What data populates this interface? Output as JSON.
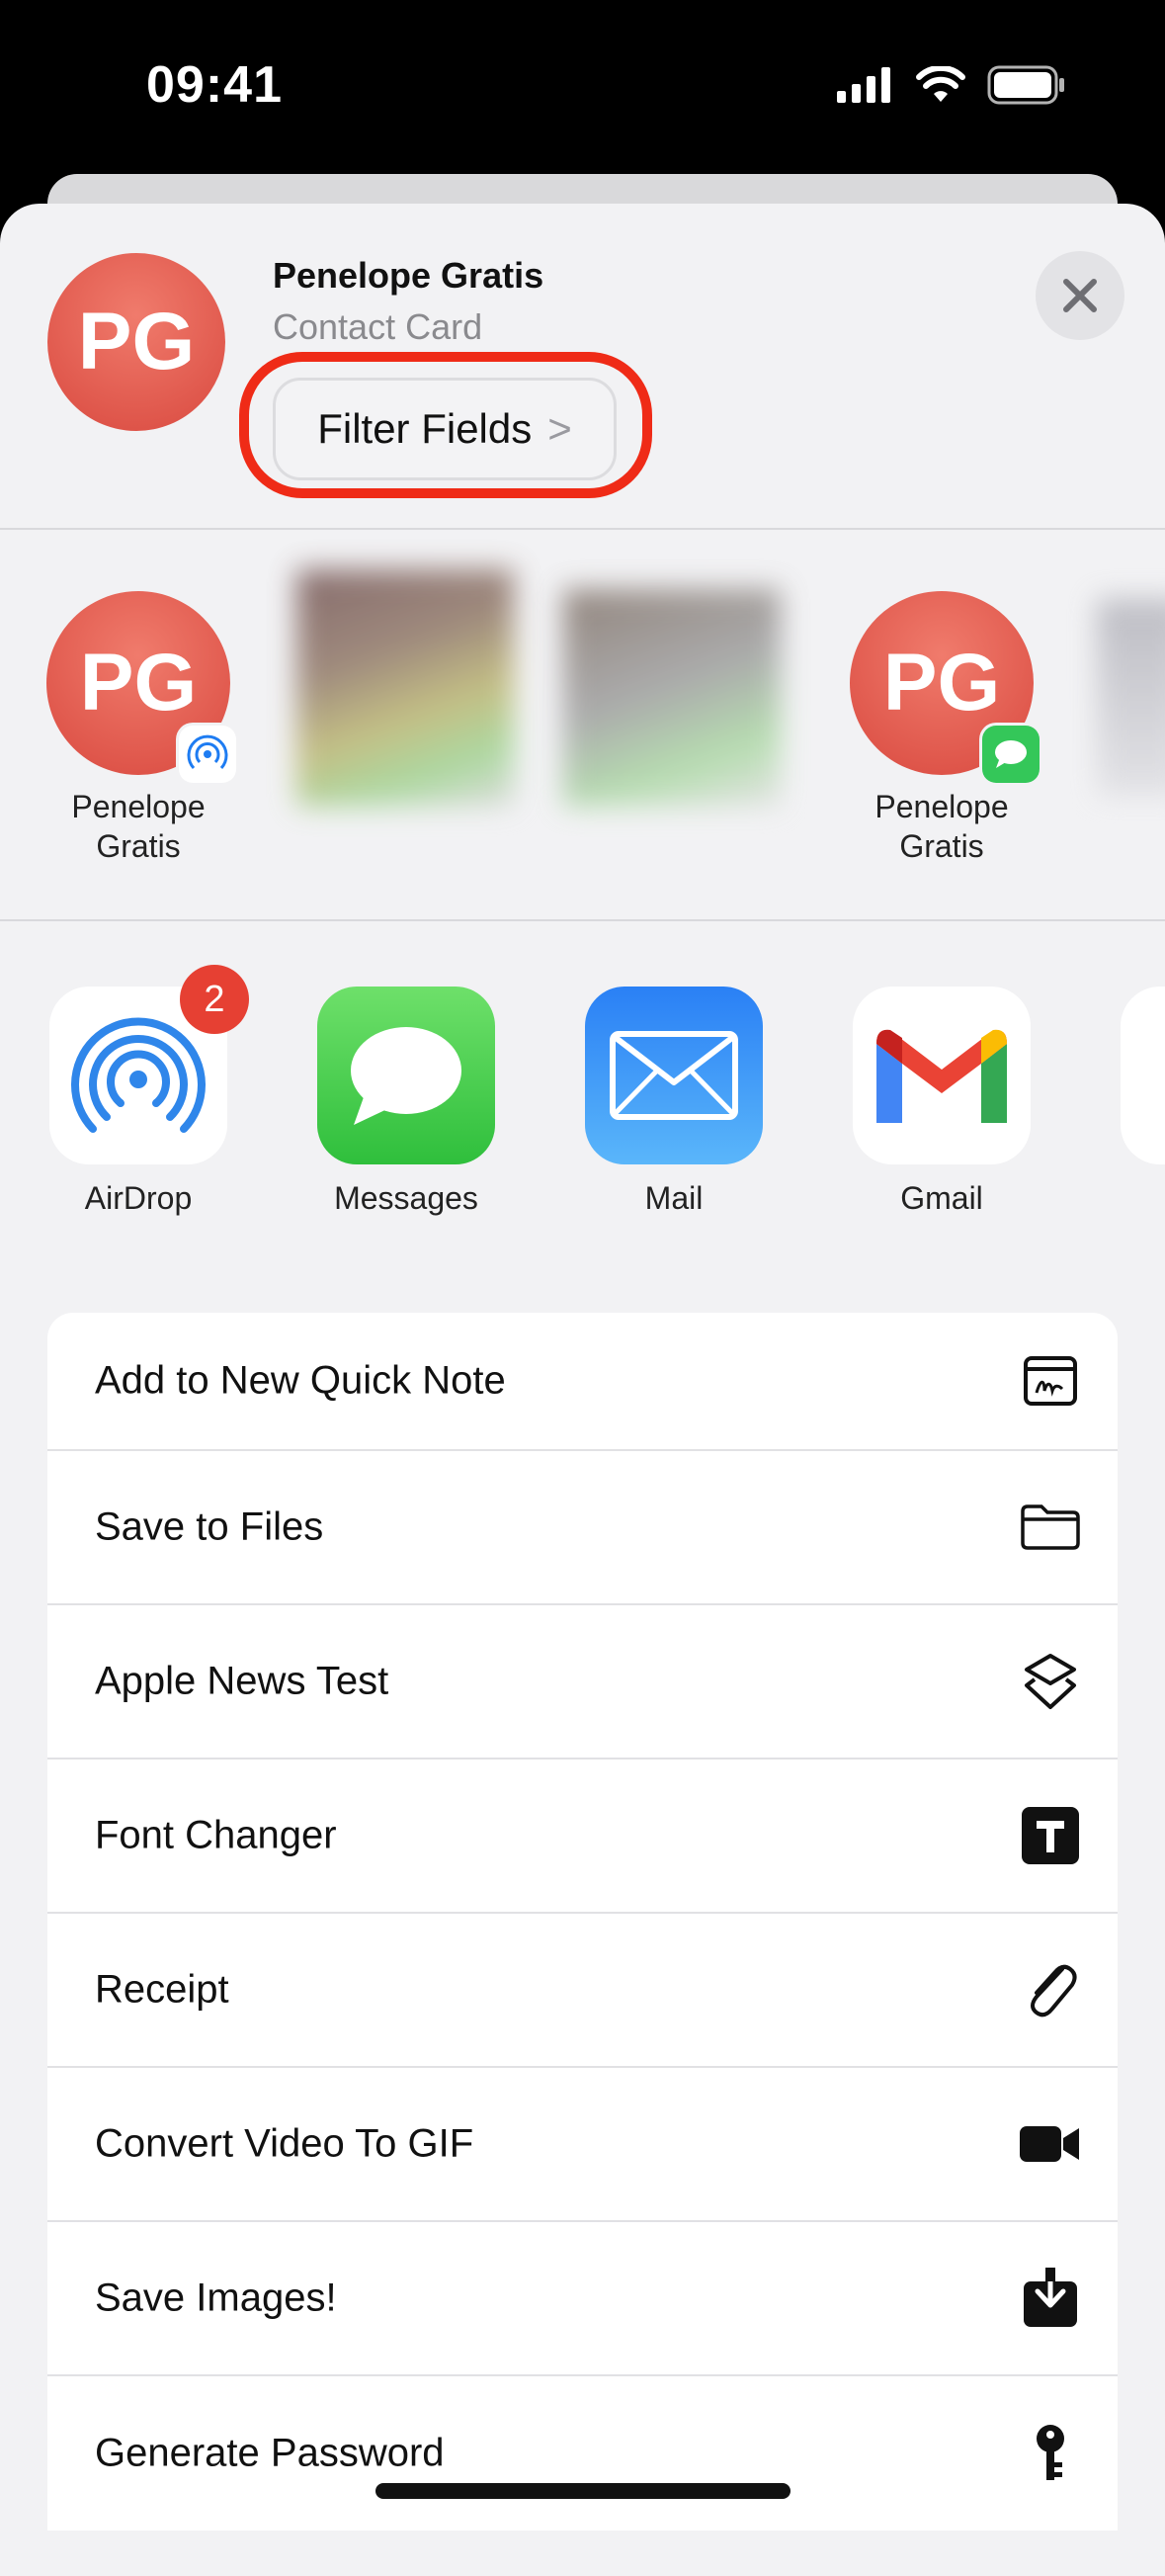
{
  "status_bar": {
    "time": "09:41"
  },
  "header": {
    "avatar_initials": "PG",
    "name": "Penelope Gratis",
    "subtitle": "Contact Card",
    "filter_button": "Filter Fields",
    "filter_chevron": ">"
  },
  "people": [
    {
      "initials": "PG",
      "first": "Penelope",
      "last": "Gratis",
      "badge_icon": "airdrop-icon"
    },
    {
      "initials": "PG",
      "first": "Penelope",
      "last": "Gratis",
      "badge_icon": "messages-icon"
    }
  ],
  "apps": [
    {
      "label": "AirDrop",
      "badge": "2"
    },
    {
      "label": "Messages"
    },
    {
      "label": "Mail"
    },
    {
      "label": "Gmail"
    }
  ],
  "actions": [
    {
      "label": "Add to New Quick Note",
      "icon": "quick-note-icon"
    },
    {
      "label": "Save to Files",
      "icon": "folder-icon"
    },
    {
      "label": "Apple News Test",
      "icon": "shortcuts-layers-icon"
    },
    {
      "label": "Font Changer",
      "icon": "letter-t-icon"
    },
    {
      "label": "Receipt",
      "icon": "paperclip-icon"
    },
    {
      "label": "Convert Video To GIF",
      "icon": "video-camera-icon"
    },
    {
      "label": "Save Images!",
      "icon": "download-tray-icon"
    },
    {
      "label": "Generate Password",
      "icon": "key-icon"
    }
  ],
  "colors": {
    "accent_red": "#ef2b17",
    "avatar_red": "#e0574b",
    "messages_green": "#34c759",
    "mail_blue": "#1e7cf2"
  }
}
